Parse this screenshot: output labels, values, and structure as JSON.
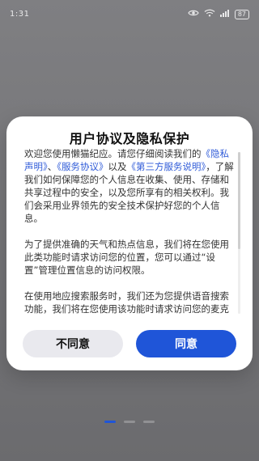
{
  "status_bar": {
    "time": "1:31",
    "battery": "87"
  },
  "dialog": {
    "title": "用户协议及隐私保护",
    "paragraphs": [
      {
        "p1_text1": "欢迎您使用懒猫纪应。请您仔细阅读我们的",
        "p1_link1": "《隐私声明》",
        "p1_text2": "、",
        "p1_link2": "《服务协议》",
        "p1_text3": "以及",
        "p1_link3": "《第三方服务说明》",
        "p1_text4": "，了解我们如何保障您的个人信息在收集、使用、存储和共享过程中的安全，以及您所享有的相关权利。我们会采用业界领先的安全技术保护好您的个人信息。"
      }
    ],
    "p2": "为了提供准确的天气和热点信息，我们将在您使用此类功能时请求访问您的位置，您可以通过“设置”管理位置信息的访问权限。",
    "p3": "在使用地应搜索服务时，我们还为您提供语音搜索功能，我们将在您使用该功能时请求访问您的麦克风，获取您语音输入的信息。",
    "buttons": {
      "decline": "不同意",
      "agree": "同意"
    }
  },
  "colors": {
    "accent": "#1f55d8",
    "link": "#2f5bd8"
  }
}
